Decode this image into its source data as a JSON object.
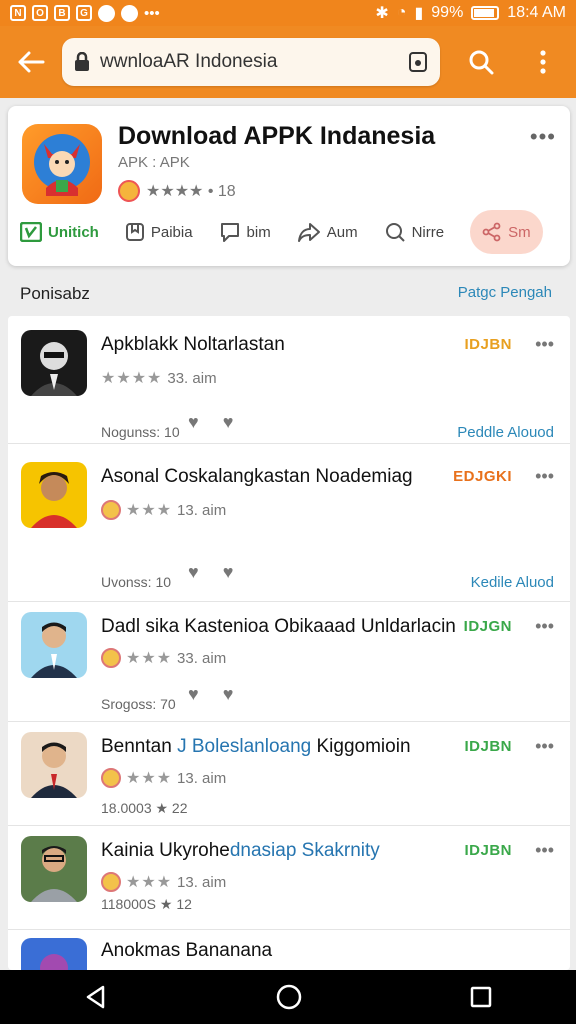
{
  "status_bar": {
    "left_icons": [
      "N",
      "O",
      "B",
      "G",
      "P"
    ],
    "battery": "99%",
    "time": "18:4 AM"
  },
  "app_bar": {
    "url": "wwnloaAR Indonesia"
  },
  "app_card": {
    "title": "Download APPK Indanesia",
    "subtitle": "APK : APK",
    "rating_text": "★★★★ • 18",
    "actions": [
      {
        "label": "Unitich",
        "icon": "install-icon"
      },
      {
        "label": "Paibia",
        "icon": "bookmark-icon"
      },
      {
        "label": "bim",
        "icon": "comment-icon"
      },
      {
        "label": "Aum",
        "icon": "forward-icon"
      },
      {
        "label": "Nirre",
        "icon": "search-icon"
      },
      {
        "label": "Sm",
        "icon": "share-icon"
      }
    ]
  },
  "section": {
    "title": "Ponisabz",
    "link": "Patgc Pengah"
  },
  "items": [
    {
      "title": "Apkblakk Noltarlastan",
      "badge": "IDJBN",
      "badge_color": "#e8a020",
      "rating": "33. aim",
      "meta": "Nogunss: 10",
      "action": "Peddle Alouod"
    },
    {
      "title": "Asonal Coskalangkastan Noademiag",
      "badge": "EDJGKI",
      "badge_color": "#e8711c",
      "rating": "13. aim",
      "meta": "Uvonss: 10",
      "action": "Kedile Aluod"
    },
    {
      "title": "Dadl sika Kastenioa Obikaaad Unldarlacin",
      "badge": "IDJGN",
      "badge_color": "#3aa84a",
      "rating": "33. aim",
      "meta": "Srogoss: 70",
      "action": ""
    },
    {
      "title_plain": "Benntan ",
      "title_hl": "J Boleslanloang",
      "title_end": " Kiggomioin",
      "badge": "IDJBN",
      "badge_color": "#3aa84a",
      "rating": "13. aim",
      "meta": "18.0003 ★ 22",
      "action": ""
    },
    {
      "title_plain": "Kainia Ukyrohe",
      "title_hl": "dnasiap Skakrnity",
      "title_end": "",
      "badge": "IDJBN",
      "badge_color": "#3aa84a",
      "rating": "13. aim",
      "meta": "118000S ★ 12",
      "action": ""
    },
    {
      "title": "Anokmas Bananana"
    }
  ]
}
